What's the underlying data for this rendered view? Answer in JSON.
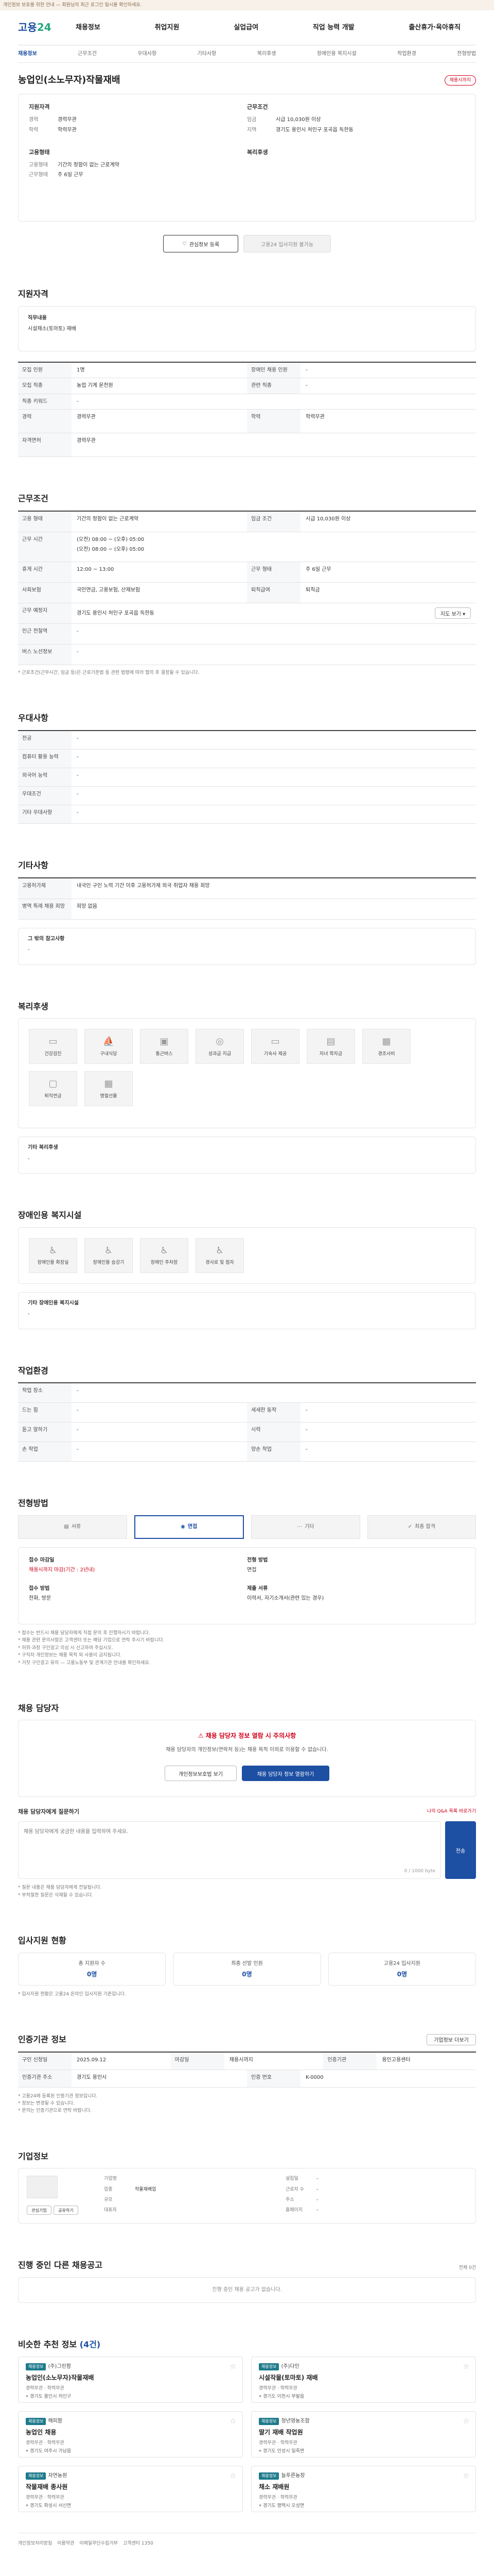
{
  "alert": "개인정보 보호를 위한 안내 — 회원님의 최근 로그인 일시를 확인하세요.",
  "logo": {
    "main": "고용",
    "accent": "24"
  },
  "gnb": [
    "채용정보",
    "취업지원",
    "실업급여",
    "직업 능력 개발",
    "출산휴가·육아휴직"
  ],
  "subnav": [
    "채용정보",
    "근무조건",
    "우대사항",
    "기타사항",
    "복리후생",
    "장애인용 복지시설",
    "작업환경",
    "전형방법",
    "채용 담당자",
    "입사지원 현황",
    "인증기관 정보",
    "기업정보",
    "진행 중인 다른 채용공고"
  ],
  "job": {
    "title": "농업인(소노무자)작물재배",
    "status": "채용시까지",
    "left": [
      {
        "label": "경력",
        "value": "경력무관"
      },
      {
        "label": "학력",
        "value": "학력무관"
      }
    ],
    "right": [
      {
        "label": "임금",
        "value": "시급 10,030원 이상"
      },
      {
        "label": "지역",
        "value": "경기도 용인시 처인구 포곡읍 독한동"
      }
    ],
    "work_head_l": "고용형태",
    "work_head_r": "복리후생",
    "work": [
      {
        "label": "고용형태",
        "value": "기간의 정함이 없는 근로계약"
      },
      {
        "label": "근무형태",
        "value": "주 6일 근무"
      }
    ],
    "labels": {
      "info": "지원자격",
      "cond": "근무조건"
    },
    "btn_fav": "관심정보 등록",
    "btn_apply": "고용24 입사지원 불가능"
  },
  "qual": {
    "title": "지원자격",
    "inner_label": "직무내용",
    "inner_value": "시설채소(토마토) 재배",
    "rows": [
      [
        "모집 인원",
        "1명",
        "장애인 채용 인원",
        "-"
      ],
      [
        "모집 직종",
        "농업 기계 운전원",
        "관련 직종",
        "-"
      ]
    ],
    "single": [
      [
        "직종 키워드",
        "-"
      ],
      [
        "경력",
        "경력무관"
      ],
      [
        "학력",
        "학력무관"
      ]
    ],
    "edu_label": "전공",
    "edu_value": "-",
    "license_label": "자격면허",
    "license_value": "경력무관"
  },
  "cond": {
    "title": "근무조건",
    "r1": [
      "고용 형태",
      "기간의 정함이 없는 근로계약",
      "임금 조건",
      "시급 10,030원 이상"
    ],
    "r2_label": "근무 시간",
    "r2_val1": "(오전) 08:00 ~ (오후) 05:00",
    "r2_val2": "(오전) 08:00 ~ (오후) 05:00",
    "r3": [
      "휴게 시간",
      "12:00 ~ 13:00",
      "근무 형태",
      "주 6일 근무"
    ],
    "r4": [
      "사회보험",
      "국민연금, 고용보험, 산재보험",
      "퇴직급여",
      "퇴직금"
    ],
    "r5_label": "근무 예정지",
    "r5_value": "경기도 용인시 처인구 포곡읍 독한동",
    "r5_btn": "지도 보기 ▾",
    "r6": [
      "인근 전철역",
      "-"
    ],
    "r7": [
      "버스 노선정보",
      "-"
    ],
    "note": "* 근로조건(근무시간, 임금 등)은 근로기준법 등 관련 법령에 따라 협의 후 결정될 수 있습니다."
  },
  "pref": {
    "title": "우대사항",
    "rows": [
      [
        "전공",
        "-"
      ],
      [
        "컴퓨터 활용 능력",
        "-"
      ],
      [
        "외국어 능력",
        "-"
      ],
      [
        "우대조건",
        "-"
      ],
      [
        "기타 우대사항",
        "-"
      ]
    ]
  },
  "etc": {
    "title": "기타사항",
    "rows": [
      [
        "고용허가제",
        "내국인 구인 노력 기간 이후 고용허가제 외국 취업자 채용 희망"
      ],
      [
        "병역 특례 채용 희망",
        "희망 없음"
      ]
    ],
    "sub_label": "그 밖의 참고사항",
    "sub_value": "-"
  },
  "welfare": {
    "title": "복리후생",
    "icons": [
      [
        "pc",
        "건강검진"
      ],
      [
        "boat",
        "구내식당"
      ],
      [
        "bus",
        "통근버스"
      ],
      [
        "coin",
        "성과급 지급"
      ],
      [
        "pc",
        "기숙사 제공"
      ],
      [
        "book",
        "자녀 학자금"
      ],
      [
        "doc",
        "경조사비"
      ],
      [
        "box",
        "퇴직연금"
      ],
      [
        "doc",
        "명절선물"
      ]
    ],
    "sub_label": "기타 복리후생",
    "sub_value": "-"
  },
  "facility": {
    "title": "장애인용 복지시설",
    "icons": [
      [
        "chair",
        "장애인용 화장실"
      ],
      [
        "chair",
        "장애인용 승강기"
      ],
      [
        "chair",
        "장애인 주차장"
      ],
      [
        "chair",
        "경사로 및 점자"
      ]
    ],
    "sub_label": "기타 장애인용 복지시설",
    "sub_value": "-"
  },
  "env": {
    "title": "작업환경",
    "rows": [
      [
        "작업 장소",
        "-",
        "",
        ""
      ],
      [
        "드는 힘",
        "-",
        "세세한 동작",
        "-"
      ],
      [
        "듣고 말하기",
        "-",
        "시력",
        "-"
      ],
      [
        "손 작업",
        "-",
        "양손 작업",
        "-"
      ]
    ]
  },
  "screen": {
    "title": "전형방법",
    "steps": [
      "서류",
      "면접",
      "기타",
      "최종 합격"
    ],
    "l1": "접수 마감일",
    "v1": "채용시까지 마감(기간 : 2년내)",
    "l2": "전형 방법",
    "v2": "면접",
    "l3": "접수 방법",
    "v3": "전화, 방문",
    "l4": "제출 서류",
    "v4": "이력서, 자기소개서(관련 있는 경우)",
    "notes": [
      "* 접수는 반드시 채용 담당자에게 직접 문의 후 진행하시기 바랍니다.",
      "* 채용 관련 문의사항은 고객센터 또는 해당 기업으로 연락 주시기 바랍니다.",
      "* 허위·과장 구인광고 의심 시 신고하여 주십시오.",
      "* 구직자 개인정보는 채용 목적 외 사용이 금지됩니다.",
      "* 거짓 구인광고 유의 — 고용노동부 및 관계기관 안내를 확인하세요."
    ]
  },
  "contact": {
    "title": "채용 담당자",
    "warn_title": "채용 담당자 정보 열람 시 주의사항",
    "warn_body": "채용 담당자의 개인정보(연락처 등)는 채용 목적 이외로 이용할 수 없습니다.",
    "btn1": "개인정보보호법 보기",
    "btn2": "채용 담당자 정보 열람하기",
    "ask_title": "채용 담당자에게 질문하기",
    "ask_right": "나의 Q&A 목록 바로가기",
    "ask_placeholder": "채용 담당자에게 궁금한 내용을 입력하여 주세요.",
    "count": "0 / 1000 byte",
    "send": "전송",
    "notes": [
      "* 질문 내용은 채용 담당자에게 전달됩니다.",
      "* 부적절한 질문은 삭제될 수 있습니다."
    ]
  },
  "apply": {
    "title": "입사지원 현황",
    "items": [
      [
        "총 지원자 수",
        "0명"
      ],
      [
        "최종 선발 인원",
        "0명"
      ],
      [
        "고용24 입사지원",
        "0명"
      ]
    ],
    "note": "* 입사지원 현황은 고용24 온라인 입사지원 기준입니다."
  },
  "cert": {
    "title": "인증기관 정보",
    "btn": "기업정보 더보기",
    "rows": [
      [
        "구인 신청일",
        "2025.09.12",
        "마감일",
        "채용시까지",
        "인증기관",
        "용인고용센터"
      ],
      [
        "인증기관 주소",
        "경기도 용인시",
        "인증 번호",
        "K-0000",
        "",
        ""
      ]
    ],
    "notes": [
      "* 고용24에 등록된 인증기관 정보입니다.",
      "* 정보는 변경될 수 있습니다.",
      "* 문의는 인증기관으로 연락 바랍니다."
    ]
  },
  "company": {
    "title": "기업정보",
    "btn1": "관심기업",
    "btn2": "공유하기",
    "left": [
      [
        "기업명",
        "",
        ""
      ],
      [
        "업종",
        "작물재배업",
        ""
      ],
      [
        "규모",
        "",
        ""
      ],
      [
        "대표자",
        "",
        ""
      ]
    ],
    "right": [
      [
        "설립일",
        "-"
      ],
      [
        "근로자 수",
        "-"
      ],
      [
        "주소",
        "-"
      ],
      [
        "홈페이지",
        "-"
      ]
    ]
  },
  "other": {
    "title": "진행 중인 다른 채용공고",
    "right": "전체 0건",
    "empty": "진행 중인 채용 공고가 없습니다."
  },
  "similar": {
    "title": "비슷한 추천 정보 ",
    "count": "(4건)",
    "cards": [
      {
        "badge": "채용정보",
        "cn": "(주)그린팜",
        "jt": "농업인(소노무자)작물재배",
        "m1": "경력무관",
        "m2": "학력무관",
        "loc": "경기도 용인시 처인구"
      },
      {
        "badge": "채용정보",
        "cn": "(주)다인",
        "jt": "시설작물(토마토) 재배",
        "m1": "경력무관",
        "m2": "학력무관",
        "loc": "경기도 이천시 부발읍"
      },
      {
        "badge": "채용정보",
        "cn": "해피팜",
        "jt": "농업인 채용",
        "m1": "경력무관",
        "m2": "학력무관",
        "loc": "경기도 여주시 가남읍"
      },
      {
        "badge": "채용정보",
        "cn": "청년영농조합",
        "jt": "딸기 재배 작업원",
        "m1": "경력무관",
        "m2": "학력무관",
        "loc": "경기도 안성시 일죽면"
      },
      {
        "badge": "채용정보",
        "cn": "자연농원",
        "jt": "작물재배 종사원",
        "m1": "경력무관",
        "m2": "학력무관",
        "loc": "경기도 화성시 서신면"
      },
      {
        "badge": "채용정보",
        "cn": "늘푸른농장",
        "jt": "채소 재배원",
        "m1": "경력무관",
        "m2": "학력무관",
        "loc": "경기도 평택시 오성면"
      }
    ]
  },
  "footer": [
    "개인정보처리방침",
    "이용약관",
    "이메일무단수집거부",
    "고객센터 1350"
  ]
}
